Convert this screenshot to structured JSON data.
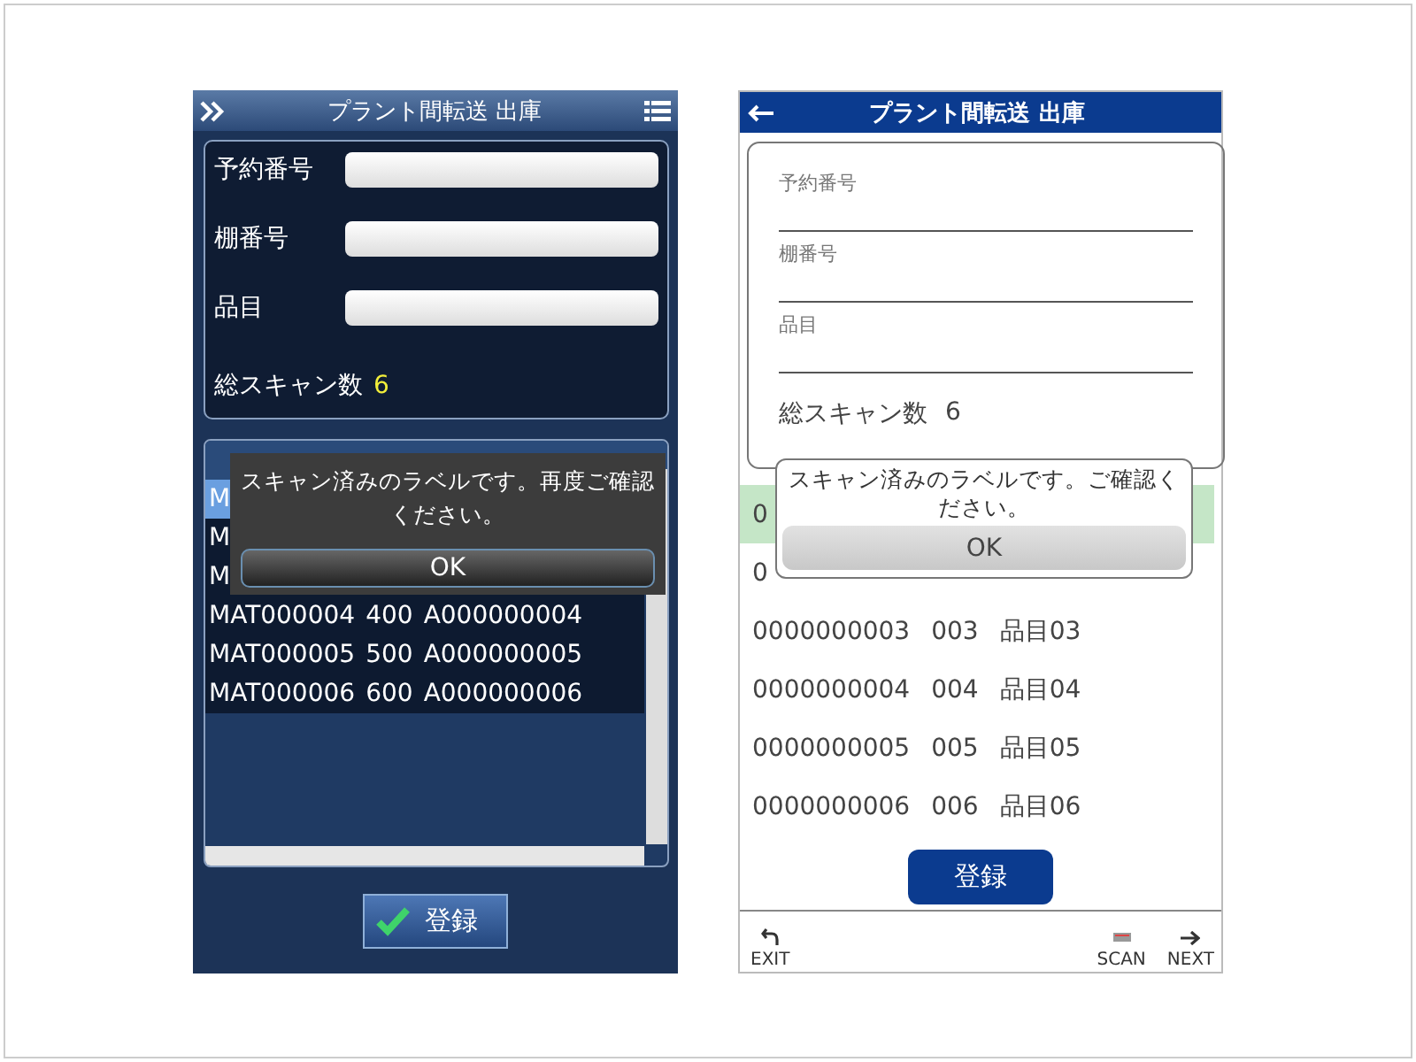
{
  "panels": [
    {
      "kind": "dark",
      "header": {
        "title": "プラント間転送 出庫"
      },
      "fields": [
        {
          "label": "予約番号"
        },
        {
          "label": "棚番号"
        },
        {
          "label": "品目"
        }
      ],
      "total": {
        "label": "総スキャン数",
        "value": "6"
      },
      "rows": [
        {
          "cells": [
            "M"
          ],
          "selected": true
        },
        {
          "cells": [
            "M"
          ],
          "selected": false
        },
        {
          "cells": [
            "M"
          ],
          "selected": false
        },
        {
          "cells": [
            "MAT000004",
            "400",
            "A000000004"
          ],
          "selected": false
        },
        {
          "cells": [
            "MAT000005",
            "500",
            "A000000005"
          ],
          "selected": false
        },
        {
          "cells": [
            "MAT000006",
            "600",
            "A000000006"
          ],
          "selected": false
        }
      ],
      "dialog": {
        "message": "スキャン済みのラベルです。再度ご確認ください。",
        "button": "OK"
      },
      "register_button": "登録"
    },
    {
      "kind": "light",
      "header": {
        "title": "プラント間転送 出庫"
      },
      "fields": [
        {
          "placeholder": "予約番号"
        },
        {
          "placeholder": "棚番号"
        },
        {
          "placeholder": "品目"
        }
      ],
      "total": {
        "label": "総スキャン数",
        "value": "6"
      },
      "rows": [
        {
          "cells": [
            "0"
          ],
          "selected": true
        },
        {
          "cells": [
            "0"
          ],
          "selected": false
        },
        {
          "cells": [
            "0000000003",
            "003",
            "品目03"
          ],
          "selected": false
        },
        {
          "cells": [
            "0000000004",
            "004",
            "品目04"
          ],
          "selected": false
        },
        {
          "cells": [
            "0000000005",
            "005",
            "品目05"
          ],
          "selected": false
        },
        {
          "cells": [
            "0000000006",
            "006",
            "品目06"
          ],
          "selected": false
        }
      ],
      "dialog": {
        "message": "スキャン済みのラベルです。ご確認ください。",
        "button": "OK"
      },
      "register_button": "登録",
      "toolbar": [
        {
          "kind": "exit",
          "label": "EXIT"
        },
        {
          "kind": "scan",
          "label": "SCAN"
        },
        {
          "kind": "next",
          "label": "NEXT"
        }
      ]
    }
  ]
}
